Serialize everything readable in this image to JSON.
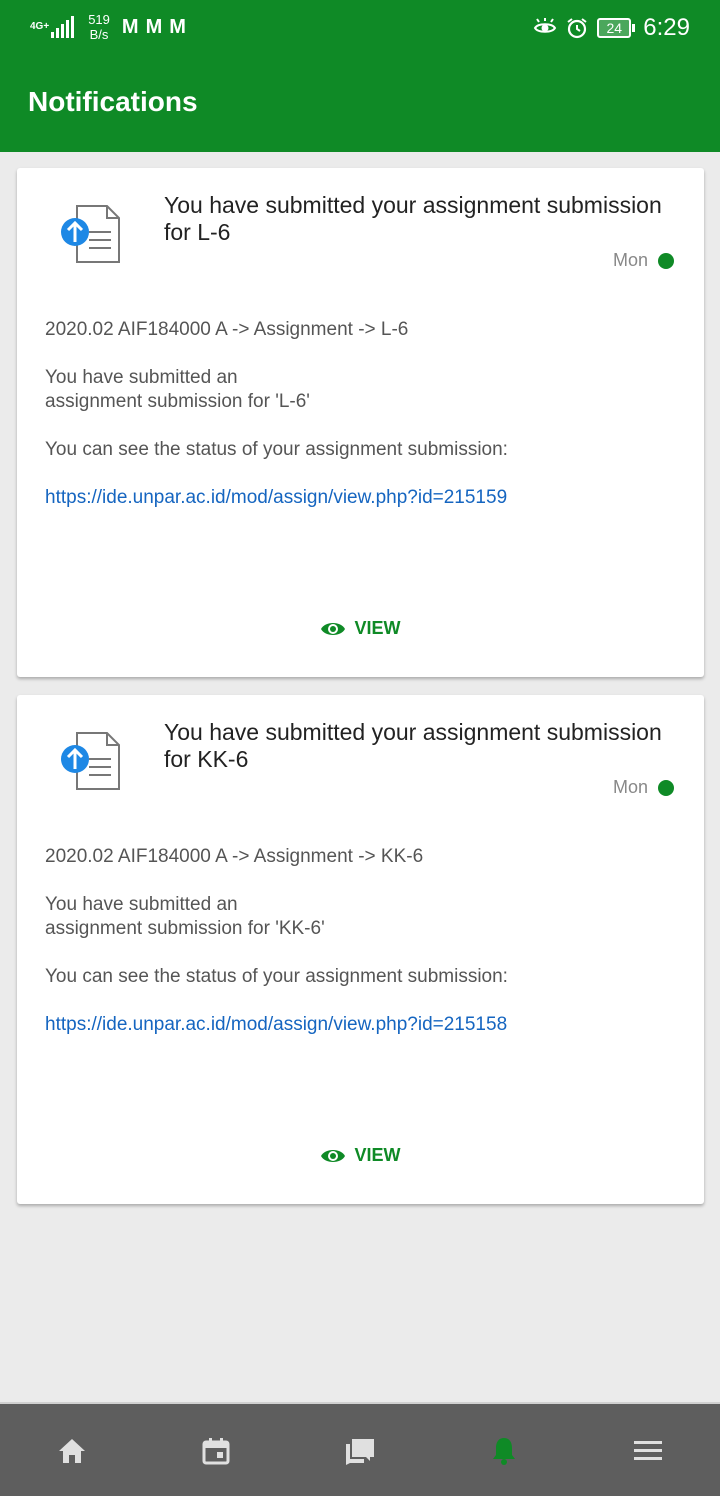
{
  "status_bar": {
    "network": "4G+",
    "speed_value": "519",
    "speed_unit": "B/s",
    "mail_icons": [
      "M",
      "M",
      "M"
    ],
    "battery": "24",
    "time": "6:29"
  },
  "header": {
    "title": "Notifications"
  },
  "notifications": [
    {
      "subject": "You have submitted your assignment submission for L-6",
      "time": "Mon",
      "breadcrumb": "2020.02 AIF184000 A -> Assignment -> L-6",
      "message_line1": "You have submitted an",
      "message_line2": "assignment submission for 'L-6'",
      "status_text": "You can see the status of your assignment submission:",
      "link": "https://ide.unpar.ac.id/mod/assign/view.php?id=215159",
      "action_label": "VIEW"
    },
    {
      "subject": "You have submitted your assignment submission for KK-6",
      "time": "Mon",
      "breadcrumb": "2020.02 AIF184000 A -> Assignment -> KK-6",
      "message_line1": "You have submitted an",
      "message_line2": "assignment submission for 'KK-6'",
      "status_text": "You can see the status of your assignment submission:",
      "link": "https://ide.unpar.ac.id/mod/assign/view.php?id=215158",
      "action_label": "VIEW"
    }
  ],
  "bottom_nav": {
    "items": [
      "home-icon",
      "calendar-icon",
      "messages-icon",
      "notifications-icon",
      "menu-icon"
    ],
    "active": "notifications-icon"
  },
  "colors": {
    "primary": "#0f8a26",
    "link": "#1565c0",
    "upload_blue": "#1e88e5",
    "nav_background": "#5e5e5e"
  }
}
